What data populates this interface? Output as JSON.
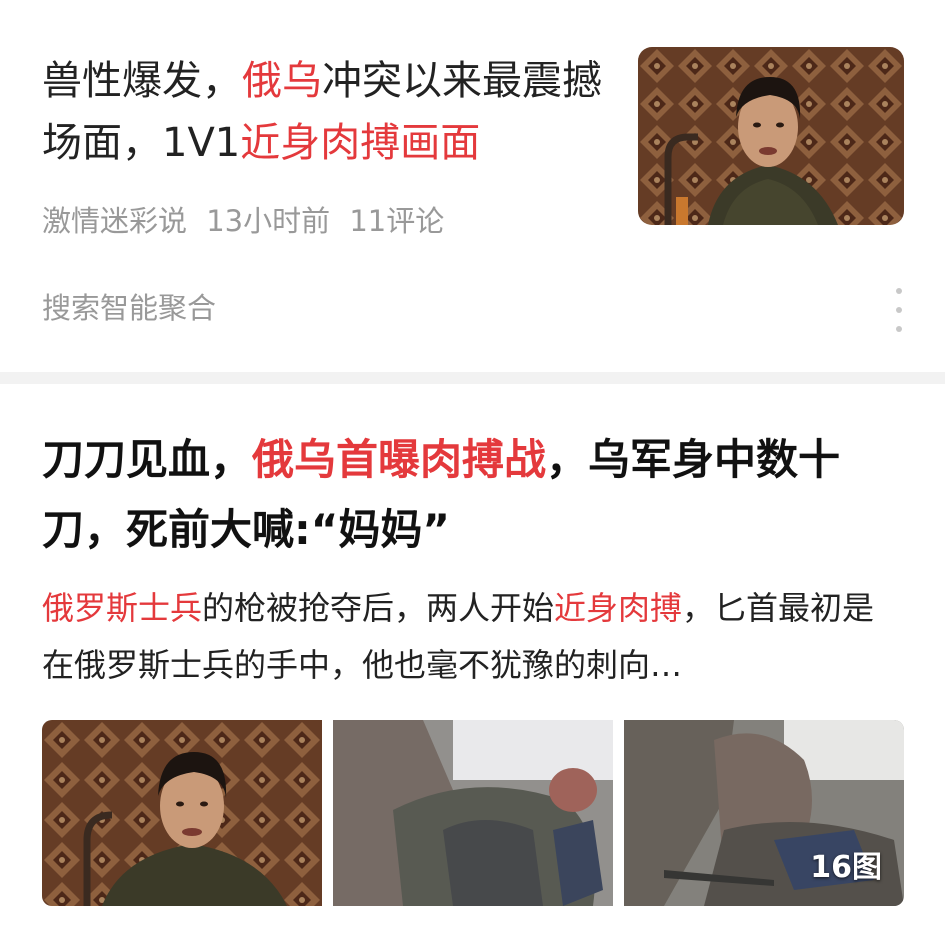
{
  "card1": {
    "title_parts": [
      {
        "text": "兽性爆发，",
        "highlight": false
      },
      {
        "text": "俄乌",
        "highlight": true
      },
      {
        "text": "冲突以来最震撼场面，1V1",
        "highlight": false
      },
      {
        "text": "近身肉搏画面",
        "highlight": true
      }
    ],
    "source": "激情迷彩说",
    "time": "13小时前",
    "comments": "11评论",
    "aggregation": "搜索智能聚合",
    "thumbnail_icon": "photo-man-portrait"
  },
  "card2": {
    "title_parts": [
      {
        "text": "刀刀见血，",
        "highlight": false
      },
      {
        "text": "俄乌首曝肉搏战",
        "highlight": true
      },
      {
        "text": "，乌军身中数十刀，死前大喊:“妈妈”",
        "highlight": false
      }
    ],
    "summary_parts": [
      {
        "text": "俄罗斯士兵",
        "highlight": true
      },
      {
        "text": "的枪被抢夺后，两人开始",
        "highlight": false
      },
      {
        "text": "近身肉搏",
        "highlight": true
      },
      {
        "text": "，匕首最初是在俄罗斯士兵的手中，他也毫不犹豫的刺向…",
        "highlight": false
      }
    ],
    "image_count": "16图",
    "images": [
      "photo-man-portrait",
      "photo-combat-blur",
      "photo-combat-blur-2"
    ]
  },
  "colors": {
    "highlight": "#e4393c",
    "meta": "#999999",
    "divider": "#f2f2f2"
  }
}
